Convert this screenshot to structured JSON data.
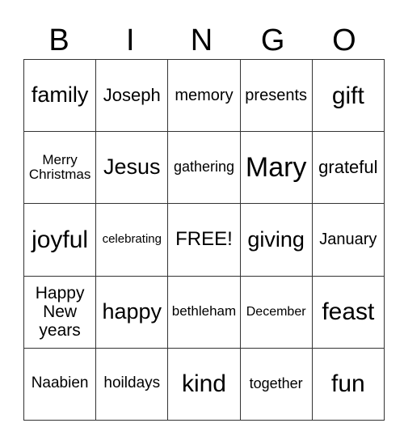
{
  "header": [
    "B",
    "I",
    "N",
    "G",
    "O"
  ],
  "rows": [
    [
      "family",
      "Joseph",
      "memory",
      "presents",
      "gift"
    ],
    [
      "Merry Christmas",
      "Jesus",
      "gathering",
      "Mary",
      "grateful"
    ],
    [
      "joyful",
      "celebrating",
      "FREE!",
      "giving",
      "January"
    ],
    [
      "Happy New years",
      "happy",
      "bethleham",
      "December",
      "feast"
    ],
    [
      "Naabien",
      "hoildays",
      "kind",
      "together",
      "fun"
    ]
  ]
}
